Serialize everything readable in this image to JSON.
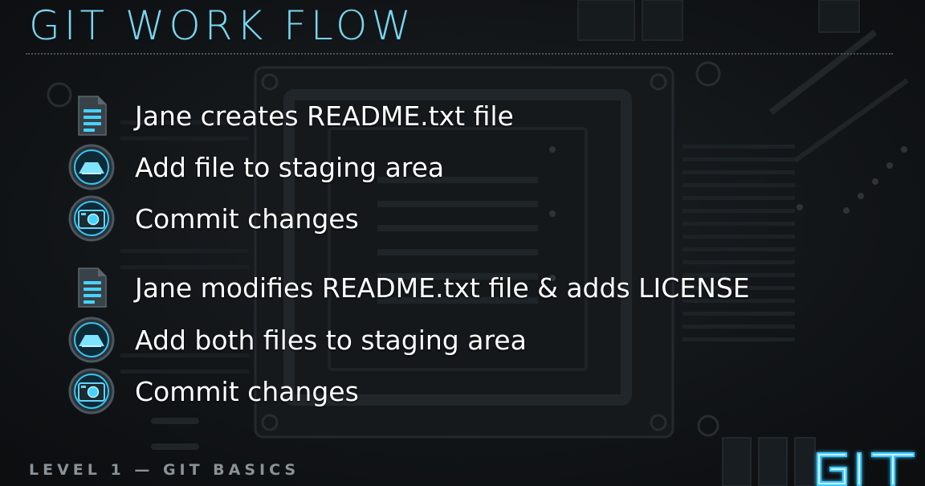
{
  "slide": {
    "title": "GIT WORK FLOW",
    "footer": "LEVEL 1 — GIT BASICS",
    "logo_text": "GIT"
  },
  "steps": [
    {
      "icon": "document-icon",
      "text": "Jane creates README.txt file"
    },
    {
      "icon": "staging-icon",
      "text": "Add file to staging area"
    },
    {
      "icon": "camera-icon",
      "text": "Commit changes"
    },
    {
      "icon": "document-icon",
      "text": "Jane modifies README.txt file & adds LICENSE"
    },
    {
      "icon": "staging-icon",
      "text": "Add both files to staging area"
    },
    {
      "icon": "camera-icon",
      "text": "Commit changes"
    }
  ],
  "colors": {
    "accent": "#79d6f0",
    "glow": "#3fc8ff",
    "background": "#111417",
    "footer_text": "#8a9297"
  }
}
